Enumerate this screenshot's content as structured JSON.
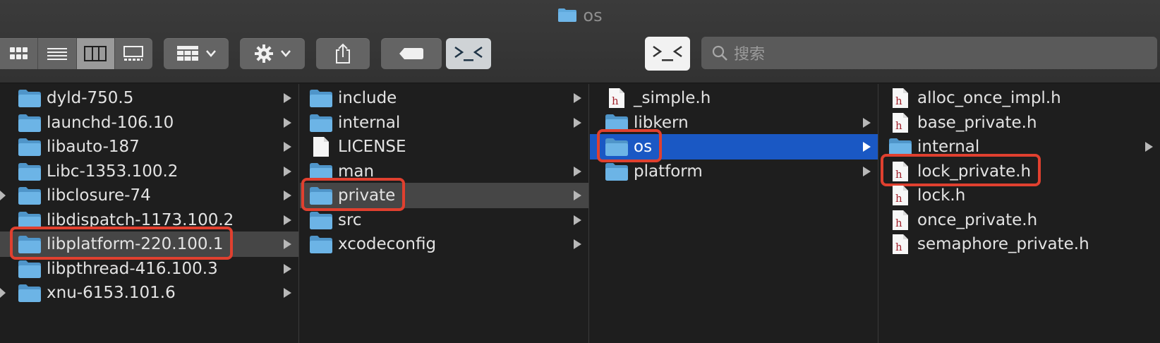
{
  "window": {
    "title": "os"
  },
  "toolbar": {
    "view_modes": [
      "icon-view",
      "list-view",
      "column-view",
      "gallery-view"
    ],
    "active_view": "column-view",
    "group_icon": "group-grid-icon",
    "action_icon": "gear-icon",
    "share_icon": "share-icon",
    "tag_icon": "tag-icon",
    "terminal_icon": "terminal-icon"
  },
  "search": {
    "placeholder": "搜索"
  },
  "columns": [
    {
      "items": [
        {
          "name": "dyld-750.5",
          "type": "folder"
        },
        {
          "name": "launchd-106.10",
          "type": "folder"
        },
        {
          "name": "libauto-187",
          "type": "folder"
        },
        {
          "name": "Libc-1353.100.2",
          "type": "folder"
        },
        {
          "name": "libclosure-74",
          "type": "folder"
        },
        {
          "name": "libdispatch-1173.100.2",
          "type": "folder"
        },
        {
          "name": "libplatform-220.100.1",
          "type": "folder",
          "state": "selected-inactive",
          "marked": true
        },
        {
          "name": "libpthread-416.100.3",
          "type": "folder"
        },
        {
          "name": "xnu-6153.101.6",
          "type": "folder"
        }
      ]
    },
    {
      "items": [
        {
          "name": "include",
          "type": "folder"
        },
        {
          "name": "internal",
          "type": "folder"
        },
        {
          "name": "LICENSE",
          "type": "file"
        },
        {
          "name": "man",
          "type": "folder"
        },
        {
          "name": "private",
          "type": "folder",
          "state": "selected-inactive",
          "marked": true
        },
        {
          "name": "src",
          "type": "folder"
        },
        {
          "name": "xcodeconfig",
          "type": "folder"
        }
      ]
    },
    {
      "items": [
        {
          "name": "_simple.h",
          "type": "header"
        },
        {
          "name": "libkern",
          "type": "folder"
        },
        {
          "name": "os",
          "type": "folder",
          "state": "selected-active",
          "marked": true
        },
        {
          "name": "platform",
          "type": "folder"
        }
      ]
    },
    {
      "items": [
        {
          "name": "alloc_once_impl.h",
          "type": "header"
        },
        {
          "name": "base_private.h",
          "type": "header"
        },
        {
          "name": "internal",
          "type": "folder"
        },
        {
          "name": "lock_private.h",
          "type": "header",
          "marked": true
        },
        {
          "name": "lock.h",
          "type": "header"
        },
        {
          "name": "once_private.h",
          "type": "header"
        },
        {
          "name": "semaphore_private.h",
          "type": "header"
        }
      ]
    }
  ],
  "colors": {
    "selection_active": "#1a58c4",
    "selection_inactive": "#464646",
    "folder": "#5fa9dd",
    "annotation": "#e0402f"
  }
}
